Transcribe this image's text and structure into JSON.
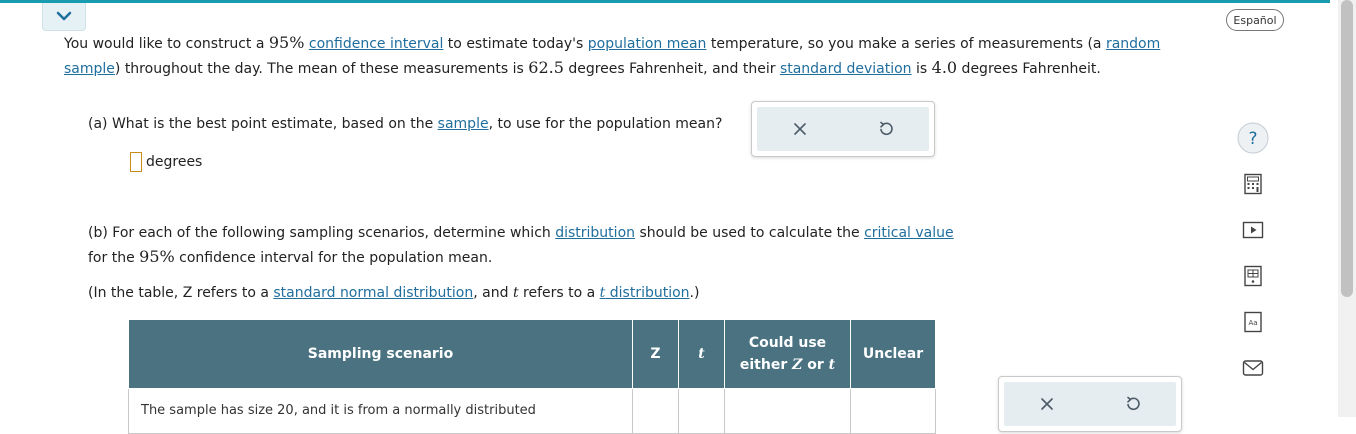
{
  "header": {
    "language_button": "Español"
  },
  "intro": {
    "t1": "You would like to construct a ",
    "conf": "95%",
    "link_ci": "confidence interval",
    "t2": " to estimate today's ",
    "link_pm": "population mean",
    "t3": " temperature, so you make a series of measurements (a ",
    "link_rs1": "random",
    "link_rs2": "sample",
    "t4": ") throughout the day. The mean of these measurements is ",
    "mean": "62.5",
    "t5": " degrees Fahrenheit, and their ",
    "link_sd": "standard deviation",
    "t6": " is ",
    "sd": "4.0",
    "t7": " degrees Fahrenheit."
  },
  "part_a": {
    "q1": "(a) What is the best point estimate, based on the ",
    "link_sample": "sample",
    "q2": ", to use for the population mean?",
    "unit": "degrees"
  },
  "part_b": {
    "q1": "(b) For each of the following sampling scenarios, determine which ",
    "link_dist": "distribution",
    "q2": " should be used to calculate the ",
    "link_cv": "critical value",
    "q3": "for the ",
    "conf": "95%",
    "q4": " confidence interval for the population mean.",
    "note1": "(In the table, Z refers to a ",
    "link_snd": "standard normal distribution",
    "note2": ", and ",
    "note_t": "t",
    "note3": " refers to a ",
    "link_td_t": "t",
    "link_td": " distribution",
    "note4": ".)"
  },
  "table": {
    "headers": {
      "scenario": "Sampling scenario",
      "z": "Z",
      "t": "t",
      "either1": "Could use",
      "either2": "either ",
      "either_z": "Z",
      "either_or": " or ",
      "either_t": "t",
      "unclear": "Unclear"
    },
    "rows": [
      {
        "scenario": "The sample has size 20, and it is from a normally distributed"
      }
    ]
  },
  "icons": {
    "collapse": "chevron-down-icon",
    "clear": "close-icon",
    "undo": "undo-icon",
    "help": "help-icon",
    "calculator": "calculator-icon",
    "video": "video-icon",
    "table": "data-table-icon",
    "glossary": "glossary-icon",
    "mail": "mail-icon"
  },
  "colors": {
    "accent": "#1a9cb0",
    "link": "#1f6e9e",
    "table_header": "#4a7280",
    "answer_border": "#c98b1a"
  }
}
